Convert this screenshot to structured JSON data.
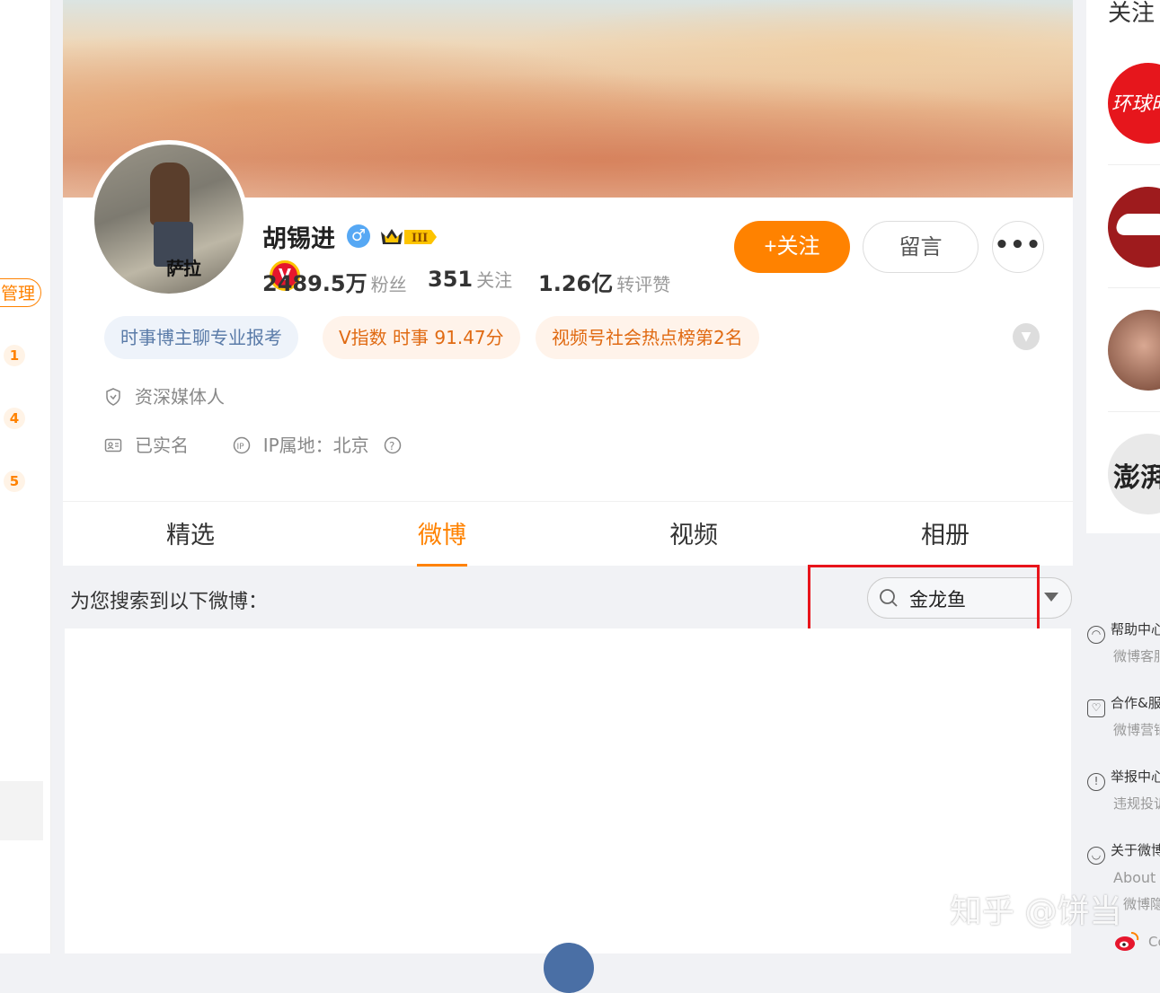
{
  "left_sidebar": {
    "manage_label": "管理",
    "badges": [
      "1",
      "4",
      "5"
    ]
  },
  "profile": {
    "name": "胡锡进",
    "avatar_caption": "萨拉",
    "verified_badge": "V",
    "stats": [
      {
        "value": "2489.5万",
        "label": "粉丝"
      },
      {
        "value": "351",
        "label": "关注"
      },
      {
        "value": "1.26亿",
        "label": "转评赞"
      }
    ],
    "follow_label": "+关注",
    "message_label": "留言",
    "more_label": "•••",
    "tags": [
      "时事博主聊专业报考",
      "V指数 时事 91.47分",
      "视频号社会热点榜第2名"
    ],
    "role": "资深媒体人",
    "real_name": "已实名",
    "ip_location": "IP属地：北京"
  },
  "tabs": [
    "精选",
    "微博",
    "视频",
    "相册"
  ],
  "active_tab": 1,
  "search": {
    "result_label": "为您搜索到以下微博：",
    "query": "金龙鱼"
  },
  "right_column": {
    "follow_title": "关注",
    "follow_avatars": [
      "环球时报",
      "",
      "",
      "澎湃"
    ],
    "help_items": [
      {
        "title": "帮助中心",
        "sub": "微博客服"
      },
      {
        "title": "合作&服务",
        "sub": "微博营销"
      },
      {
        "title": "举报中心",
        "sub": "违规投诉"
      },
      {
        "title": "关于微博",
        "sub": "About W"
      }
    ],
    "privacy_line": "微博隐私",
    "copyright": "Co"
  },
  "watermark": "知乎 @饼当",
  "colors": {
    "accent": "#ff8200",
    "highlight_box": "#e8141b",
    "verified": "#e6162d"
  }
}
